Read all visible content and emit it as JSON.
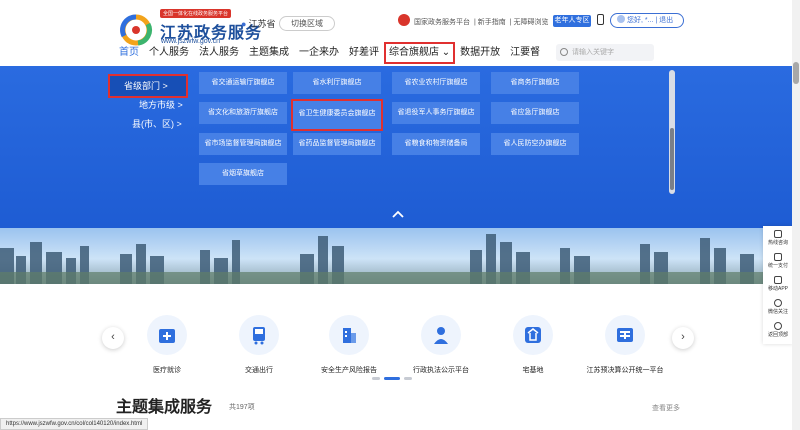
{
  "header": {
    "logo_badge": "全国一体化在线政务服务平台",
    "logo_title": "江苏政务服务",
    "logo_url": "www.jszwfw.gov.cn",
    "location": "江苏省",
    "switch_region": "切换区域",
    "top_links": [
      "国家政务服务平台",
      "新手指南",
      "无障碍浏览"
    ],
    "elder_zone": "老年人专区",
    "user": "您好, *...",
    "logout": "退出"
  },
  "nav": {
    "items": [
      "首页",
      "个人服务",
      "法人服务",
      "主题集成",
      "一企来办",
      "好差评",
      "综合旗舰店",
      "数据开放",
      "江要督"
    ],
    "search_placeholder": "请输入关键字"
  },
  "mega": {
    "categories": [
      "省级部门 >",
      "地方市级 >",
      "县(市、区) >"
    ],
    "tiles": [
      "省交通运输厅旗舰店",
      "省水利厅旗舰店",
      "省农业农村厅旗舰店",
      "省商务厅旗舰店",
      "省文化和旅游厅旗舰店",
      "省卫生健康委员会旗舰店",
      "省退役军人事务厅旗舰店",
      "省应急厅旗舰店",
      "省市场监督管理局旗舰店",
      "省药品监督管理局旗舰店",
      "省粮食和物资储备局",
      "省人民防空办旗舰店",
      "省烟草旗舰店"
    ]
  },
  "services": {
    "items": [
      "医疗就诊",
      "交通出行",
      "安全生产风险报告",
      "行政执法公示平台",
      "宅基地",
      "江苏预决算公开统一平台"
    ]
  },
  "section": {
    "title": "主题集成服务",
    "count": "共197项",
    "more": "查看更多"
  },
  "rail": [
    "热线咨询",
    "统一支付",
    "移动APP",
    "微信关注",
    "返回顶部"
  ],
  "status_url": "https://www.jszwfw.gov.cn/col/col140120/index.html"
}
